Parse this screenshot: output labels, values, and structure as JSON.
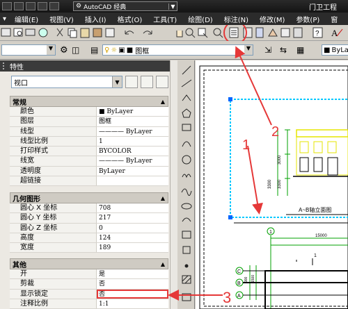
{
  "titlebar": {
    "workspace": "AutoCAD 经典",
    "app_title": "门卫工程"
  },
  "menu": [
    "编辑(E)",
    "视图(V)",
    "插入(I)",
    "格式(O)",
    "工具(T)",
    "绘图(D)",
    "标注(N)",
    "修改(M)",
    "参数(P)",
    "窗"
  ],
  "layer": {
    "name": "图框",
    "color_value": "ByLay"
  },
  "palette": {
    "title": "特性",
    "object_type": "视口",
    "sections": [
      {
        "name": "常规",
        "rows": [
          {
            "key": "颜色",
            "value": "■ ByLayer"
          },
          {
            "key": "图层",
            "value": "图框"
          },
          {
            "key": "线型",
            "value": "———— ByLayer"
          },
          {
            "key": "线型比例",
            "value": "1"
          },
          {
            "key": "打印样式",
            "value": "BYCOLOR"
          },
          {
            "key": "线宽",
            "value": "———— ByLayer"
          },
          {
            "key": "透明度",
            "value": "ByLayer"
          },
          {
            "key": "超链接",
            "value": ""
          }
        ]
      },
      {
        "name": "几何图形",
        "rows": [
          {
            "key": "圆心 X 坐标",
            "value": "708"
          },
          {
            "key": "圆心 Y 坐标",
            "value": "217"
          },
          {
            "key": "圆心 Z 坐标",
            "value": "0"
          },
          {
            "key": "高度",
            "value": "124"
          },
          {
            "key": "宽度",
            "value": "189"
          }
        ]
      },
      {
        "name": "其他",
        "rows": [
          {
            "key": "开",
            "value": "是"
          },
          {
            "key": "剪裁",
            "value": "否"
          },
          {
            "key": "显示锁定",
            "value": "否"
          },
          {
            "key": "注释比例",
            "value": "1:1"
          }
        ]
      }
    ]
  },
  "drawing": {
    "elevation_title": "A~B轴立面图",
    "axis_labels": [
      "1",
      "C",
      "B",
      "A"
    ],
    "dims": [
      "3000",
      "3300",
      "3300",
      "15000",
      "900",
      "1500",
      "1500"
    ]
  },
  "annotations": [
    "1",
    "2",
    "3"
  ],
  "colors": {
    "annotation_red": "#e53838",
    "title_bg": "#1c1c1c",
    "menu_bg": "#2b2b2b",
    "palette_bg": "#ece9e3",
    "viewport_border": "#00c8ff",
    "drawing_yellow": "#e6e600",
    "drawing_green": "#00a000"
  }
}
